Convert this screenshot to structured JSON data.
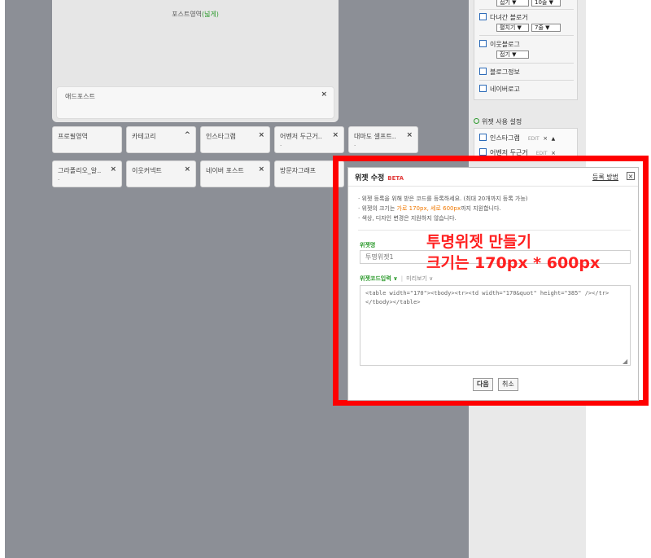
{
  "canvas": {
    "post_area_caption_prefix": "포스트영역",
    "post_area_caption_green": "(넓게)"
  },
  "add_post": {
    "label": "애드포스트"
  },
  "widgets": {
    "profile": "프로필영역",
    "category": "카테고리",
    "instagram": "인스타그램",
    "evangel": "어벤저 두근거..",
    "tamado": "대마도 셀프트..",
    "gallery": "그라폴리오_알..",
    "neighbor": "이웃커넥트",
    "naver_post": "네이버 포스트",
    "visitor": "방문자그래프",
    "close_symbol": "×",
    "up_symbol": "^",
    "sub_dot": "."
  },
  "sidebar": {
    "row0": {
      "selects": [
        "접기  ▼",
        "10줄  ▼"
      ]
    },
    "row1": {
      "label": "다녀간 블로거",
      "selects": [
        "펼치기 ▼",
        "7줄  ▼"
      ]
    },
    "row2": {
      "label": "이웃블로그",
      "selects": [
        "접기  ▼"
      ]
    },
    "row3": {
      "label": "블로그정보"
    },
    "row4": {
      "label": "네이버로고"
    },
    "settings_title": "위젯 사용 설정",
    "settings_row1": {
      "label": "인스타그램",
      "edit": "EDIT",
      "close": "×",
      "arrow": "▲"
    },
    "settings_row2": {
      "label": "어벤저 두근거",
      "edit": "EDIT",
      "close": "×"
    }
  },
  "dialog": {
    "title": "위젯 수정",
    "beta": "BETA",
    "help_link": "등록 방법",
    "close_symbol": "×",
    "desc1": "· 위젯 등록을 위해 받은 코드를 등록하세요. (최대 20개까지 등록 가능)",
    "desc2_a": "· 위젯의 크기는 ",
    "desc2_b": "가로 170px, 세로 600px",
    "desc2_c": "까지 지원합니다.",
    "desc3": "· 색상, 디자인 변경은 지원하지 않습니다.",
    "name_label": "위젯명",
    "name_value": "투명위젯1",
    "tab_code": "위젯코드입력 ∨",
    "tab_sep": "|",
    "tab_preview": "미리보기 ∨",
    "code_value": "<table width=\"170\"><tbody><tr><td width=\"170&quot\" height=\"385\" /></tr></tbody></table>",
    "btn_ok": "다음",
    "btn_cancel": "취소"
  },
  "overlay": {
    "line1": "투명위젯 만들기",
    "line2": "크기는 170px * 600px"
  },
  "colors": {
    "highlight": "#ff0000",
    "accent_green": "#2e9b2e",
    "overlay_text": "#ff2020"
  }
}
